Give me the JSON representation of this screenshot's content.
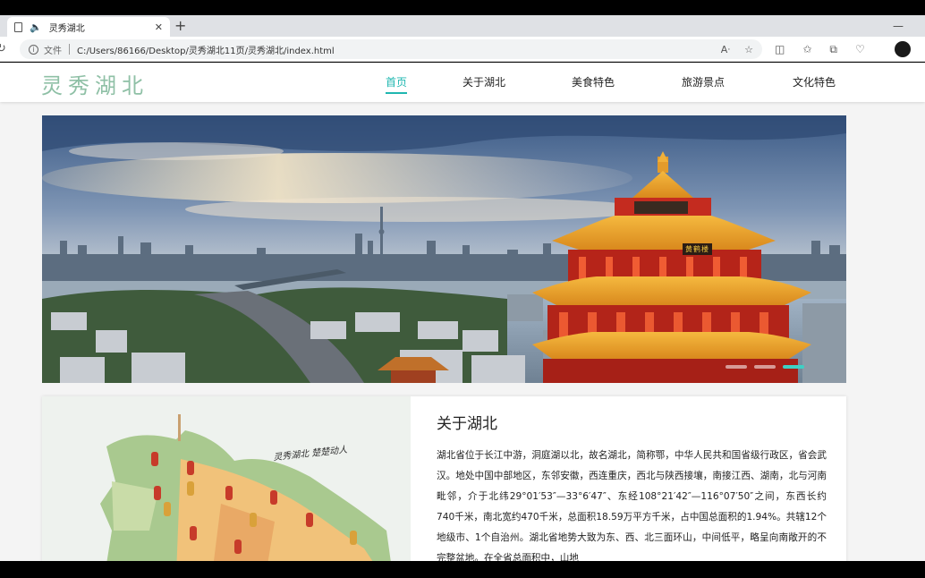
{
  "browser": {
    "tab_title": "灵秀湖北",
    "new_tab": "+",
    "minimize": "—",
    "file_label": "文件",
    "url": "C:/Users/86166/Desktop/灵秀湖北11页/灵秀湖北/index.html",
    "icons": [
      "read-aloud-icon",
      "favorite-icon",
      "split-screen-icon",
      "favorites-icon",
      "collections-icon",
      "extensions-icon"
    ]
  },
  "site": {
    "logo": "灵秀湖北",
    "nav": [
      {
        "label": "首页",
        "active": true
      },
      {
        "label": "关于湖北",
        "active": false
      },
      {
        "label": "美食特色",
        "active": false
      },
      {
        "label": "旅游景点",
        "active": false
      },
      {
        "label": "文化特色",
        "active": false
      }
    ],
    "accent_color": "#1fb7b0",
    "logo_color": "#8fc0a6"
  },
  "banner": {
    "image": "yellow-crane-tower-wuhan-skyline",
    "tower_plaque": "黄鹤楼",
    "slides": 3,
    "active_slide": 3
  },
  "about": {
    "map_caption": "灵秀湖北 楚楚动人",
    "title": "关于湖北",
    "body": "湖北省位于长江中游，洞庭湖以北，故名湖北，简称鄂，中华人民共和国省级行政区，省会武汉。地处中国中部地区，东邻安徽，西连重庆，西北与陕西接壤，南接江西、湖南，北与河南毗邻，介于北纬29°01′53″—33°6′47″、东经108°21′42″—116°07′50″之间，东西长约740千米，南北宽约470千米，总面积18.59万平方千米，占中国总面积的1.94%。共辖12个地级市、1个自治州。湖北省地势大致为东、西、北三面环山，中间低平，略呈向南敞开的不完整盆地。在全省总面积中，山地"
  }
}
